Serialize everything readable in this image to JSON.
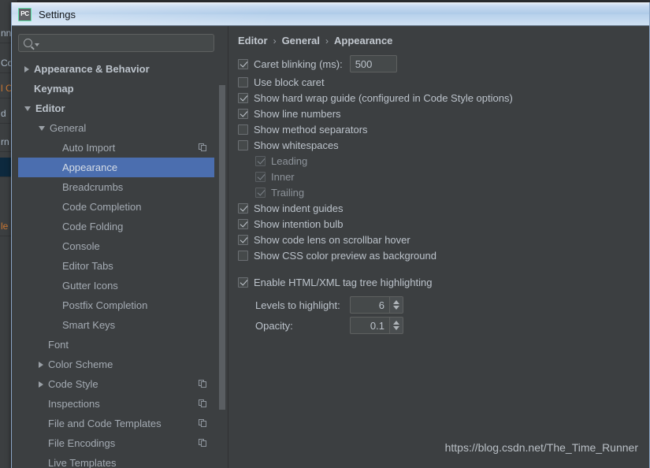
{
  "window": {
    "title": "Settings",
    "app_icon_label": "PC",
    "accent_green": "#21d789",
    "titlebar_color": "#aecbe8"
  },
  "background_ide": {
    "fragments": [
      "nn",
      "Co",
      "l C",
      "d",
      "rn",
      "le"
    ]
  },
  "search": {
    "value": "",
    "placeholder": ""
  },
  "tree": {
    "selection_color": "#4b6eaf",
    "items": [
      {
        "label": "Appearance & Behavior",
        "level": 0,
        "arrow": "right",
        "bold": true,
        "selected": false,
        "copy": false
      },
      {
        "label": "Keymap",
        "level": 0,
        "arrow": "none",
        "bold": true,
        "selected": false,
        "copy": false
      },
      {
        "label": "Editor",
        "level": 0,
        "arrow": "down",
        "bold": true,
        "selected": false,
        "copy": false
      },
      {
        "label": "General",
        "level": 1,
        "arrow": "down",
        "bold": false,
        "selected": false,
        "copy": false
      },
      {
        "label": "Auto Import",
        "level": 2,
        "arrow": "none",
        "bold": false,
        "selected": false,
        "copy": true
      },
      {
        "label": "Appearance",
        "level": 2,
        "arrow": "none",
        "bold": false,
        "selected": true,
        "copy": false
      },
      {
        "label": "Breadcrumbs",
        "level": 2,
        "arrow": "none",
        "bold": false,
        "selected": false,
        "copy": false
      },
      {
        "label": "Code Completion",
        "level": 2,
        "arrow": "none",
        "bold": false,
        "selected": false,
        "copy": false
      },
      {
        "label": "Code Folding",
        "level": 2,
        "arrow": "none",
        "bold": false,
        "selected": false,
        "copy": false
      },
      {
        "label": "Console",
        "level": 2,
        "arrow": "none",
        "bold": false,
        "selected": false,
        "copy": false
      },
      {
        "label": "Editor Tabs",
        "level": 2,
        "arrow": "none",
        "bold": false,
        "selected": false,
        "copy": false
      },
      {
        "label": "Gutter Icons",
        "level": 2,
        "arrow": "none",
        "bold": false,
        "selected": false,
        "copy": false
      },
      {
        "label": "Postfix Completion",
        "level": 2,
        "arrow": "none",
        "bold": false,
        "selected": false,
        "copy": false
      },
      {
        "label": "Smart Keys",
        "level": 2,
        "arrow": "none",
        "bold": false,
        "selected": false,
        "copy": false
      },
      {
        "label": "Font",
        "level": 1,
        "arrow": "none",
        "bold": false,
        "selected": false,
        "copy": false
      },
      {
        "label": "Color Scheme",
        "level": 1,
        "arrow": "right",
        "bold": false,
        "selected": false,
        "copy": false
      },
      {
        "label": "Code Style",
        "level": 1,
        "arrow": "right",
        "bold": false,
        "selected": false,
        "copy": true
      },
      {
        "label": "Inspections",
        "level": 1,
        "arrow": "none",
        "bold": false,
        "selected": false,
        "copy": true
      },
      {
        "label": "File and Code Templates",
        "level": 1,
        "arrow": "none",
        "bold": false,
        "selected": false,
        "copy": true
      },
      {
        "label": "File Encodings",
        "level": 1,
        "arrow": "none",
        "bold": false,
        "selected": false,
        "copy": true
      },
      {
        "label": "Live Templates",
        "level": 1,
        "arrow": "none",
        "bold": false,
        "selected": false,
        "copy": false
      }
    ]
  },
  "breadcrumb": {
    "parts": [
      "Editor",
      "General",
      "Appearance"
    ],
    "separator": "›"
  },
  "options": {
    "caret_blinking": {
      "label": "Caret blinking (ms):",
      "checked": true,
      "value": "500"
    },
    "checkboxes": [
      {
        "label": "Use block caret",
        "checked": false,
        "indent": false,
        "disabled": false,
        "gap": false
      },
      {
        "label": "Show hard wrap guide (configured in Code Style options)",
        "checked": true,
        "indent": false,
        "disabled": false,
        "gap": false
      },
      {
        "label": "Show line numbers",
        "checked": true,
        "indent": false,
        "disabled": false,
        "gap": false
      },
      {
        "label": "Show method separators",
        "checked": false,
        "indent": false,
        "disabled": false,
        "gap": false
      },
      {
        "label": "Show whitespaces",
        "checked": false,
        "indent": false,
        "disabled": false,
        "gap": false
      },
      {
        "label": "Leading",
        "checked": true,
        "indent": true,
        "disabled": true,
        "gap": false
      },
      {
        "label": "Inner",
        "checked": true,
        "indent": true,
        "disabled": true,
        "gap": false
      },
      {
        "label": "Trailing",
        "checked": true,
        "indent": true,
        "disabled": true,
        "gap": false
      },
      {
        "label": "Show indent guides",
        "checked": true,
        "indent": false,
        "disabled": false,
        "gap": false
      },
      {
        "label": "Show intention bulb",
        "checked": true,
        "indent": false,
        "disabled": false,
        "gap": false
      },
      {
        "label": "Show code lens on scrollbar hover",
        "checked": true,
        "indent": false,
        "disabled": false,
        "gap": false
      },
      {
        "label": "Show CSS color preview as background",
        "checked": false,
        "indent": false,
        "disabled": false,
        "gap": false
      },
      {
        "label": "Enable HTML/XML tag tree highlighting",
        "checked": true,
        "indent": false,
        "disabled": false,
        "gap": true
      }
    ],
    "spinners": [
      {
        "label": "Levels to highlight:",
        "value": "6"
      },
      {
        "label": "Opacity:",
        "value": "0.1"
      }
    ]
  },
  "watermark": {
    "text": "https://blog.csdn.net/The_Time_Runner"
  }
}
